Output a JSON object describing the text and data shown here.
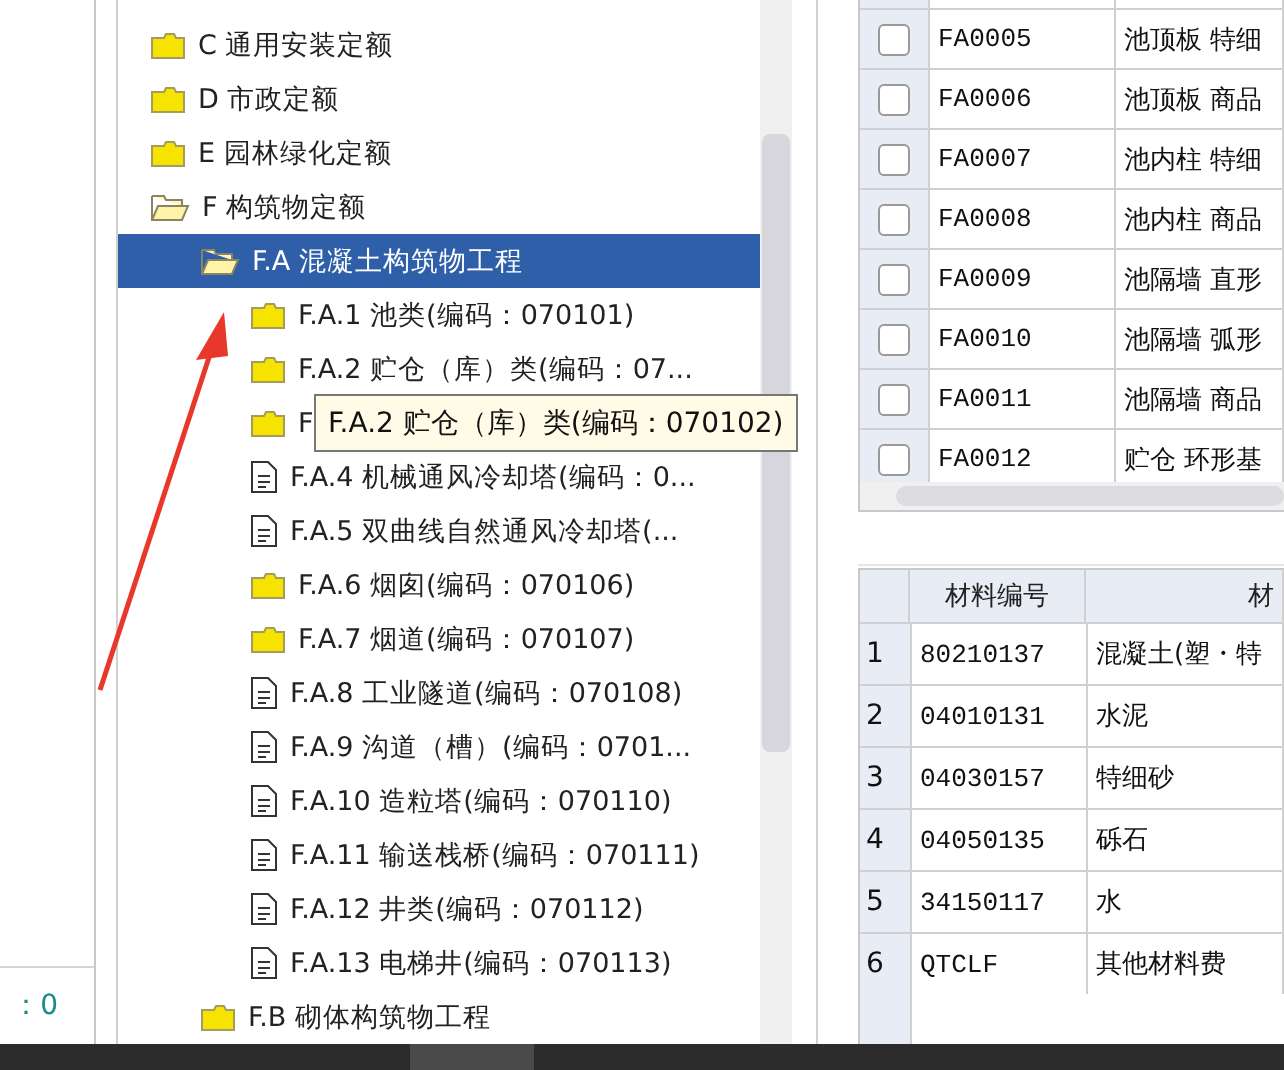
{
  "status": {
    "text": "：0"
  },
  "tree": {
    "items": [
      {
        "label": "C 通用安装定额",
        "kind": "folder",
        "selected": false
      },
      {
        "label": "D 市政定额",
        "kind": "folder",
        "selected": false
      },
      {
        "label": "E 园林绿化定额",
        "kind": "folder",
        "selected": false
      },
      {
        "label": "F 构筑物定额",
        "kind": "folder-open",
        "selected": false,
        "children": [
          {
            "label": "F.A 混凝土构筑物工程",
            "kind": "folder-open",
            "selected": true,
            "children": [
              {
                "label": "F.A.1 池类(编码：070101)",
                "kind": "folder",
                "selected": false
              },
              {
                "label": "F.A.2  贮仓（库）类(编码：07...",
                "kind": "folder",
                "selected": false
              },
              {
                "label": "F",
                "kind": "folder",
                "selected": false
              },
              {
                "label": "F.A.4 机械通风冷却塔(编码：0...",
                "kind": "document",
                "selected": false
              },
              {
                "label": "F.A.5 双曲线自然通风冷却塔(...",
                "kind": "document",
                "selected": false
              },
              {
                "label": "F.A.6 烟囱(编码：070106)",
                "kind": "folder",
                "selected": false
              },
              {
                "label": "F.A.7 烟道(编码：070107)",
                "kind": "folder",
                "selected": false
              },
              {
                "label": "F.A.8 工业隧道(编码：070108)",
                "kind": "document",
                "selected": false
              },
              {
                "label": "F.A.9 沟道（槽）(编码：0701...",
                "kind": "document",
                "selected": false
              },
              {
                "label": "F.A.10 造粒塔(编码：070110)",
                "kind": "document",
                "selected": false
              },
              {
                "label": "F.A.11 输送栈桥(编码：070111)",
                "kind": "document",
                "selected": false
              },
              {
                "label": "F.A.12 井类(编码：070112)",
                "kind": "document",
                "selected": false
              },
              {
                "label": "F.A.13 电梯井(编码：070113)",
                "kind": "document",
                "selected": false
              }
            ]
          },
          {
            "label": "F.B 砌体构筑物工程",
            "kind": "folder",
            "selected": false
          }
        ]
      }
    ]
  },
  "tooltip": {
    "text": "F.A.2  贮仓（库）类(编码：070102)"
  },
  "quota_table": {
    "rows": [
      {
        "checked": false,
        "code": "FA0005",
        "name": "池顶板 特细"
      },
      {
        "checked": false,
        "code": "FA0006",
        "name": "池顶板 商品"
      },
      {
        "checked": false,
        "code": "FA0007",
        "name": "池内柱 特细"
      },
      {
        "checked": false,
        "code": "FA0008",
        "name": "池内柱 商品"
      },
      {
        "checked": false,
        "code": "FA0009",
        "name": "池隔墙 直形"
      },
      {
        "checked": false,
        "code": "FA0010",
        "name": "池隔墙 弧形"
      },
      {
        "checked": false,
        "code": "FA0011",
        "name": "池隔墙 商品"
      },
      {
        "checked": false,
        "code": "FA0012",
        "name": "贮仓 环形基"
      }
    ]
  },
  "material_table": {
    "columns": [
      "材料编号",
      "材"
    ],
    "rows": [
      {
        "number": "1",
        "code": "80210137",
        "name": "混凝土(塑・特"
      },
      {
        "number": "2",
        "code": "04010131",
        "name": "水泥"
      },
      {
        "number": "3",
        "code": "04030157",
        "name": "特细砂"
      },
      {
        "number": "4",
        "code": "04050135",
        "name": "砾石"
      },
      {
        "number": "5",
        "code": "34150117",
        "name": "水"
      },
      {
        "number": "6",
        "code": "QTCLF",
        "name": "其他材料费"
      }
    ]
  }
}
